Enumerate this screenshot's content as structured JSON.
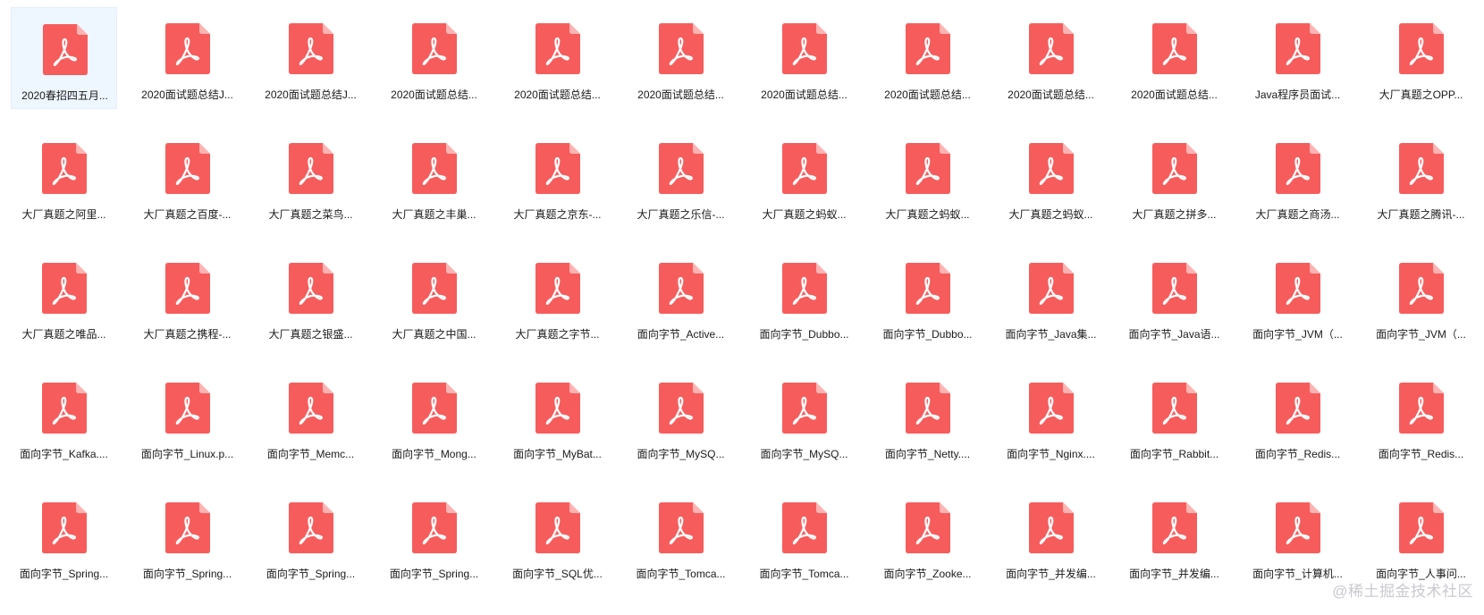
{
  "icon": "pdf-file-icon",
  "colors": {
    "pdf_red": "#f75c5c",
    "pdf_fold": "#ffb3b3",
    "selection_bg": "#eef6ff"
  },
  "files": [
    {
      "label": "2020春招四五月...",
      "selected": true
    },
    {
      "label": "2020面试题总结J..."
    },
    {
      "label": "2020面试题总结J..."
    },
    {
      "label": "2020面试题总结..."
    },
    {
      "label": "2020面试题总结..."
    },
    {
      "label": "2020面试题总结..."
    },
    {
      "label": "2020面试题总结..."
    },
    {
      "label": "2020面试题总结..."
    },
    {
      "label": "2020面试题总结..."
    },
    {
      "label": "2020面试题总结..."
    },
    {
      "label": "Java程序员面试..."
    },
    {
      "label": "大厂真题之OPP..."
    },
    {
      "label": "大厂真题之阿里..."
    },
    {
      "label": "大厂真题之百度-..."
    },
    {
      "label": "大厂真题之菜鸟..."
    },
    {
      "label": "大厂真题之丰巢..."
    },
    {
      "label": "大厂真题之京东-..."
    },
    {
      "label": "大厂真题之乐信-..."
    },
    {
      "label": "大厂真题之蚂蚁..."
    },
    {
      "label": "大厂真题之蚂蚁..."
    },
    {
      "label": "大厂真题之蚂蚁..."
    },
    {
      "label": "大厂真题之拼多..."
    },
    {
      "label": "大厂真题之商汤..."
    },
    {
      "label": "大厂真题之腾讯-..."
    },
    {
      "label": "大厂真题之唯品..."
    },
    {
      "label": "大厂真题之携程-..."
    },
    {
      "label": "大厂真题之银盛..."
    },
    {
      "label": "大厂真题之中国..."
    },
    {
      "label": "大厂真题之字节..."
    },
    {
      "label": "面向字节_Active..."
    },
    {
      "label": "面向字节_Dubbo..."
    },
    {
      "label": "面向字节_Dubbo..."
    },
    {
      "label": "面向字节_Java集..."
    },
    {
      "label": "面向字节_Java语..."
    },
    {
      "label": "面向字节_JVM（..."
    },
    {
      "label": "面向字节_JVM（..."
    },
    {
      "label": "面向字节_Kafka...."
    },
    {
      "label": "面向字节_Linux.p..."
    },
    {
      "label": "面向字节_Memc..."
    },
    {
      "label": "面向字节_Mong..."
    },
    {
      "label": "面向字节_MyBat..."
    },
    {
      "label": "面向字节_MySQ..."
    },
    {
      "label": "面向字节_MySQ..."
    },
    {
      "label": "面向字节_Netty...."
    },
    {
      "label": "面向字节_Nginx...."
    },
    {
      "label": "面向字节_Rabbit..."
    },
    {
      "label": "面向字节_Redis..."
    },
    {
      "label": "面向字节_Redis..."
    },
    {
      "label": "面向字节_Spring..."
    },
    {
      "label": "面向字节_Spring..."
    },
    {
      "label": "面向字节_Spring..."
    },
    {
      "label": "面向字节_Spring..."
    },
    {
      "label": "面向字节_SQL优..."
    },
    {
      "label": "面向字节_Tomca..."
    },
    {
      "label": "面向字节_Tomca..."
    },
    {
      "label": "面向字节_Zooke..."
    },
    {
      "label": "面向字节_并发编..."
    },
    {
      "label": "面向字节_并发编..."
    },
    {
      "label": "面向字节_计算机..."
    },
    {
      "label": "面向字节_人事问..."
    }
  ],
  "watermark": "@稀土掘金技术社区"
}
